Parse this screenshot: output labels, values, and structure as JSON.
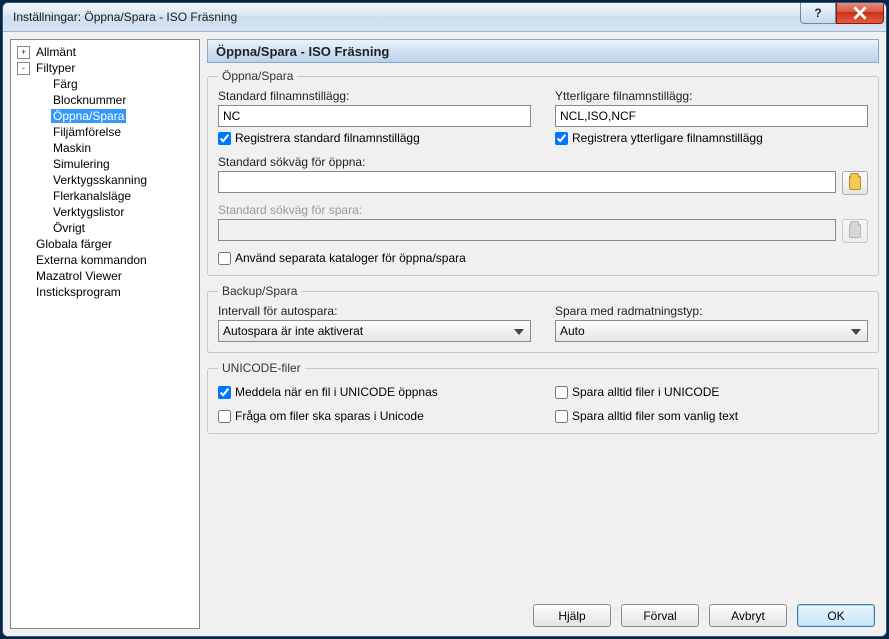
{
  "window": {
    "title": "Inställningar: Öppna/Spara - ISO Fräsning",
    "help_icon": "?",
    "close_icon": "×"
  },
  "tree": {
    "nodes": [
      {
        "name": "allmant",
        "label": "Allmänt",
        "expander": "+",
        "level": 0
      },
      {
        "name": "filtyper",
        "label": "Filtyper",
        "expander": "-",
        "level": 0
      },
      {
        "name": "farg",
        "label": "Färg",
        "level": 1
      },
      {
        "name": "blocknummer",
        "label": "Blocknummer",
        "level": 1
      },
      {
        "name": "oppna-spara",
        "label": "Öppna/Spara",
        "level": 1,
        "selected": true
      },
      {
        "name": "filjamforelse",
        "label": "Filjämförelse",
        "level": 1
      },
      {
        "name": "maskin",
        "label": "Maskin",
        "level": 1
      },
      {
        "name": "simulering",
        "label": "Simulering",
        "level": 1
      },
      {
        "name": "verktygsskanning",
        "label": "Verktygsskanning",
        "level": 1
      },
      {
        "name": "flerkanalslaege",
        "label": "Flerkanalsläge",
        "level": 1
      },
      {
        "name": "verktygslistor",
        "label": "Verktygslistor",
        "level": 1
      },
      {
        "name": "ovrigt-sub",
        "label": "Övrigt",
        "level": 1
      },
      {
        "name": "globala-farger",
        "label": "Globala färger",
        "level": 0
      },
      {
        "name": "externa-kommandon",
        "label": "Externa kommandon",
        "level": 0
      },
      {
        "name": "mazatrol-viewer",
        "label": "Mazatrol Viewer",
        "level": 0
      },
      {
        "name": "insticksprogram",
        "label": "Insticksprogram",
        "level": 0
      }
    ]
  },
  "page": {
    "header": "Öppna/Spara - ISO Fräsning",
    "open_save": {
      "legend": "Öppna/Spara",
      "std_ext_label": "Standard filnamnstillägg:",
      "std_ext_value": "NC",
      "add_ext_label": "Ytterligare filnamnstillägg:",
      "add_ext_value": "NCL,ISO,NCF",
      "reg_std_label": "Registrera standard filnamnstillägg",
      "reg_std_checked": true,
      "reg_add_label": "Registrera ytterligare filnamnstillägg",
      "reg_add_checked": true,
      "open_path_label": "Standard sökväg för öppna:",
      "open_path_value": "",
      "save_path_label": "Standard sökväg för spara:",
      "save_path_value": "",
      "separate_dirs_label": "Använd separata kataloger för öppna/spara",
      "separate_dirs_checked": false
    },
    "backup": {
      "legend": "Backup/Spara",
      "interval_label": "Intervall för autospara:",
      "interval_value": "Autospara är inte aktiverat",
      "lineend_label": "Spara med radmatningstyp:",
      "lineend_value": "Auto"
    },
    "unicode": {
      "legend": "UNICODE-filer",
      "notify_open_label": "Meddela när en fil i UNICODE öppnas",
      "notify_open_checked": true,
      "ask_save_label": "Fråga om filer ska sparas i Unicode",
      "ask_save_checked": false,
      "always_unicode_label": "Spara alltid filer i UNICODE",
      "always_unicode_checked": false,
      "always_text_label": "Spara alltid filer som vanlig text",
      "always_text_checked": false
    }
  },
  "buttons": {
    "help": "Hjälp",
    "default": "Förval",
    "cancel": "Avbryt",
    "ok": "OK"
  }
}
